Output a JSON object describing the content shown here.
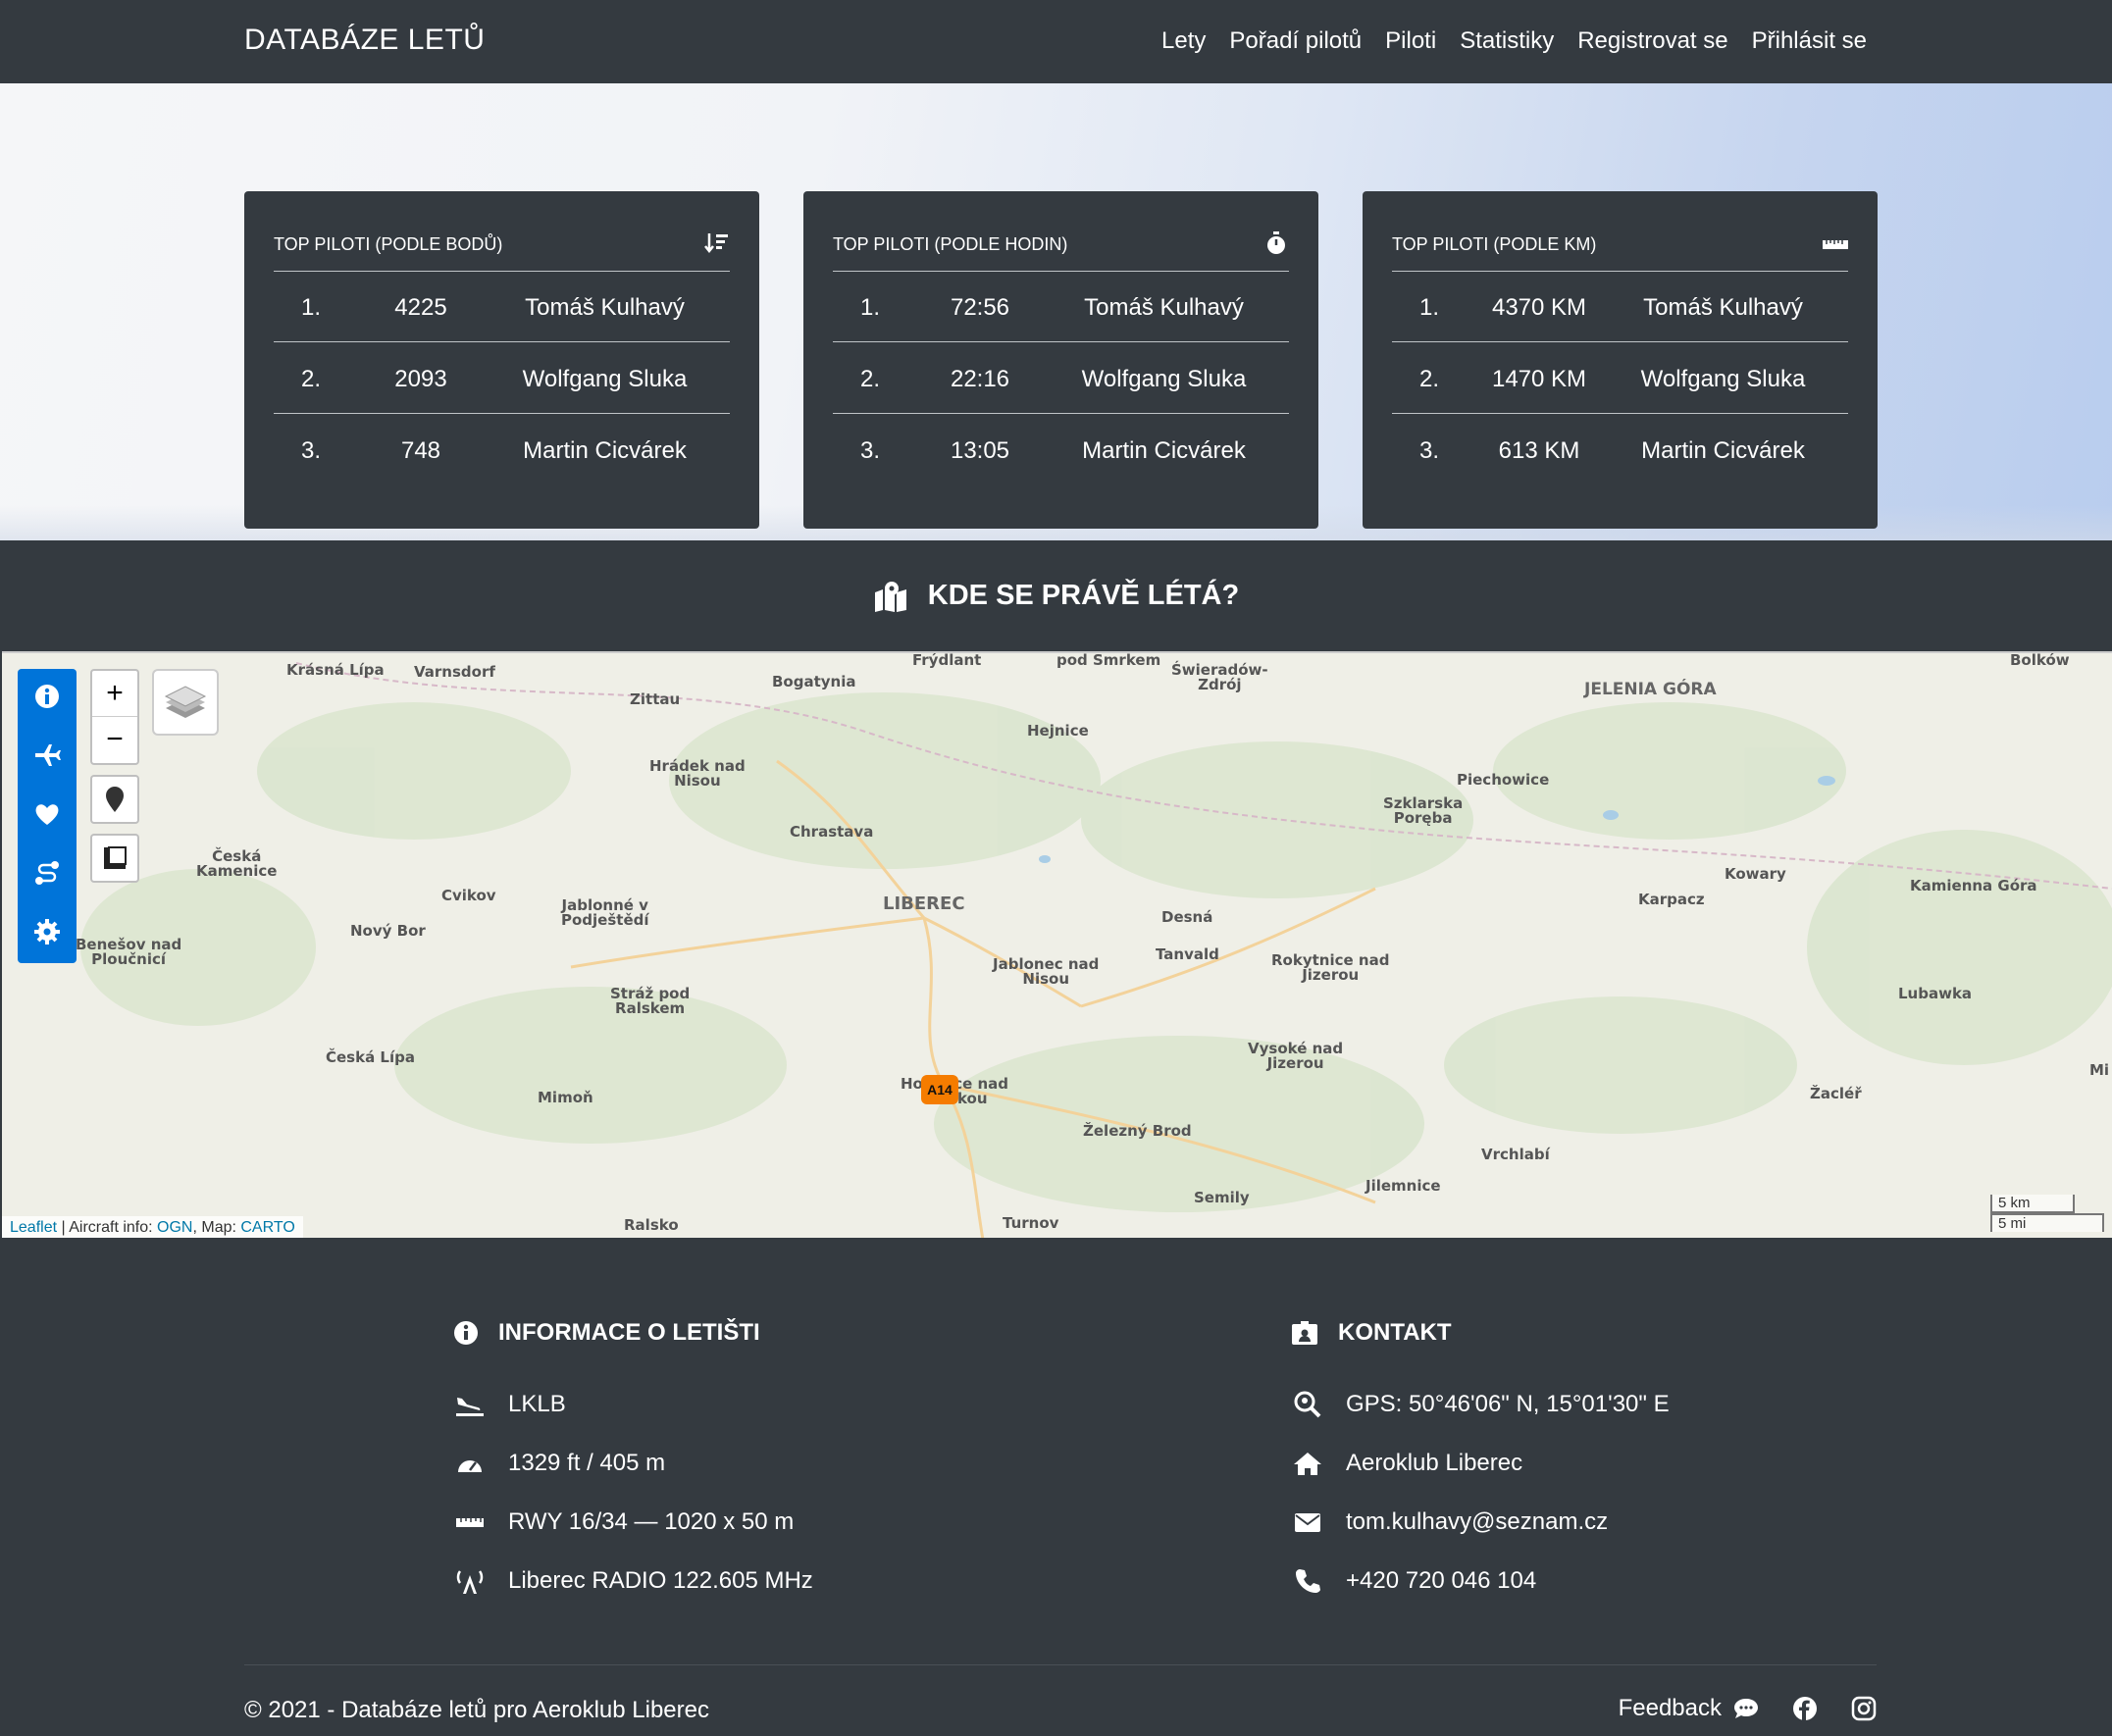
{
  "navbar": {
    "brand": "DATABÁZE LETŮ",
    "links": [
      "Lety",
      "Pořadí pilotů",
      "Piloti",
      "Statistiky",
      "Registrovat se",
      "Přihlásit se"
    ]
  },
  "cards": [
    {
      "title": "TOP PILOTI (PODLE BODŮ)",
      "icon": "sort-amount-down-icon",
      "rows": [
        {
          "rank": "1.",
          "value": "4225",
          "name": "Tomáš Kulhavý"
        },
        {
          "rank": "2.",
          "value": "2093",
          "name": "Wolfgang Sluka"
        },
        {
          "rank": "3.",
          "value": "748",
          "name": "Martin Cicvárek"
        }
      ]
    },
    {
      "title": "TOP PILOTI (PODLE HODIN)",
      "icon": "stopwatch-icon",
      "rows": [
        {
          "rank": "1.",
          "value": "72:56",
          "name": "Tomáš Kulhavý"
        },
        {
          "rank": "2.",
          "value": "22:16",
          "name": "Wolfgang Sluka"
        },
        {
          "rank": "3.",
          "value": "13:05",
          "name": "Martin Cicvárek"
        }
      ]
    },
    {
      "title": "TOP PILOTI (PODLE KM)",
      "icon": "ruler-icon",
      "rows": [
        {
          "rank": "1.",
          "value": "4370 KM",
          "name": "Tomáš Kulhavý"
        },
        {
          "rank": "2.",
          "value": "1470 KM",
          "name": "Wolfgang Sluka"
        },
        {
          "rank": "3.",
          "value": "613 KM",
          "name": "Martin Cicvárek"
        }
      ]
    }
  ],
  "map_section": {
    "title": "KDE SE PRÁVĚ LÉTÁ?",
    "zoom_in": "+",
    "zoom_out": "−",
    "marker": "A14",
    "attribution": {
      "leaflet": "Leaflet",
      "sep1": " | Aircraft info: ",
      "ogn": "OGN",
      "sep2": ", Map: ",
      "carto": "CARTO"
    },
    "scale": {
      "km": "5 km",
      "mi": "5 mi"
    },
    "places": [
      {
        "text": "Krásná Lípa",
        "cls": ""
      },
      {
        "text": "Varnsdorf",
        "cls": ""
      },
      {
        "text": "Zittau",
        "cls": ""
      },
      {
        "text": "Bogatynia",
        "cls": ""
      },
      {
        "text": "Frýdlant",
        "cls": ""
      },
      {
        "text": "pod Smrkem",
        "cls": ""
      },
      {
        "text": "Świeradów-\nZdrój",
        "cls": ""
      },
      {
        "text": "JELENIA GÓRA",
        "cls": "big"
      },
      {
        "text": "Bolków",
        "cls": ""
      },
      {
        "text": "Hejnice",
        "cls": ""
      },
      {
        "text": "Hrádek nad\nNisou",
        "cls": ""
      },
      {
        "text": "Piechowice",
        "cls": ""
      },
      {
        "text": "Szklarska\nPoręba",
        "cls": ""
      },
      {
        "text": "Chrastava",
        "cls": ""
      },
      {
        "text": "Česká\nKamenice",
        "cls": ""
      },
      {
        "text": "Kowary",
        "cls": ""
      },
      {
        "text": "Kamienna Góra",
        "cls": ""
      },
      {
        "text": "Cvikov",
        "cls": ""
      },
      {
        "text": "Jablonné v\nPodještědí",
        "cls": ""
      },
      {
        "text": "LIBEREC",
        "cls": "city"
      },
      {
        "text": "Karpacz",
        "cls": ""
      },
      {
        "text": "Nový Bor",
        "cls": ""
      },
      {
        "text": "Desná",
        "cls": ""
      },
      {
        "text": "Benešov nad\nPloučnicí",
        "cls": ""
      },
      {
        "text": "Tanvald",
        "cls": ""
      },
      {
        "text": "Jablonec nad\nNisou",
        "cls": ""
      },
      {
        "text": "Rokytnice nad\nJizerou",
        "cls": ""
      },
      {
        "text": "Stráž pod\nRalskem",
        "cls": ""
      },
      {
        "text": "Lubawka",
        "cls": ""
      },
      {
        "text": "Česká Lípa",
        "cls": ""
      },
      {
        "text": "Vysoké nad\nJizerou",
        "cls": ""
      },
      {
        "text": "Ho      ce nad\n      lkou",
        "cls": ""
      },
      {
        "text": "Mimoň",
        "cls": ""
      },
      {
        "text": "Žacléř",
        "cls": ""
      },
      {
        "text": "Mi",
        "cls": ""
      },
      {
        "text": "Železný Brod",
        "cls": ""
      },
      {
        "text": "Vrchlabí",
        "cls": ""
      },
      {
        "text": "Jilemnice",
        "cls": ""
      },
      {
        "text": "Semily",
        "cls": ""
      },
      {
        "text": "Ralsko",
        "cls": ""
      },
      {
        "text": "Turnov",
        "cls": ""
      }
    ]
  },
  "footer": {
    "airport": {
      "title": "INFORMACE O LETIŠTI",
      "items": [
        {
          "icon": "plane-landing-icon",
          "text": "LKLB"
        },
        {
          "icon": "tachometer-icon",
          "text": "1329 ft / 405 m"
        },
        {
          "icon": "ruler-icon",
          "text": "RWY 16/34 — 1020 x 50 m"
        },
        {
          "icon": "broadcast-tower-icon",
          "text": "Liberec RADIO 122.605 MHz"
        }
      ]
    },
    "contact": {
      "title": "KONTAKT",
      "items": [
        {
          "icon": "search-location-icon",
          "text": "GPS: 50°46'06\" N, 15°01'30\" E"
        },
        {
          "icon": "home-icon",
          "text": "Aeroklub Liberec"
        },
        {
          "icon": "envelope-icon",
          "text": "tom.kulhavy@seznam.cz"
        },
        {
          "icon": "phone-icon",
          "text": "+420 720 046 104"
        }
      ]
    },
    "copyright": "© 2021 - Databáze letů pro Aeroklub Liberec",
    "feedback": "Feedback"
  }
}
